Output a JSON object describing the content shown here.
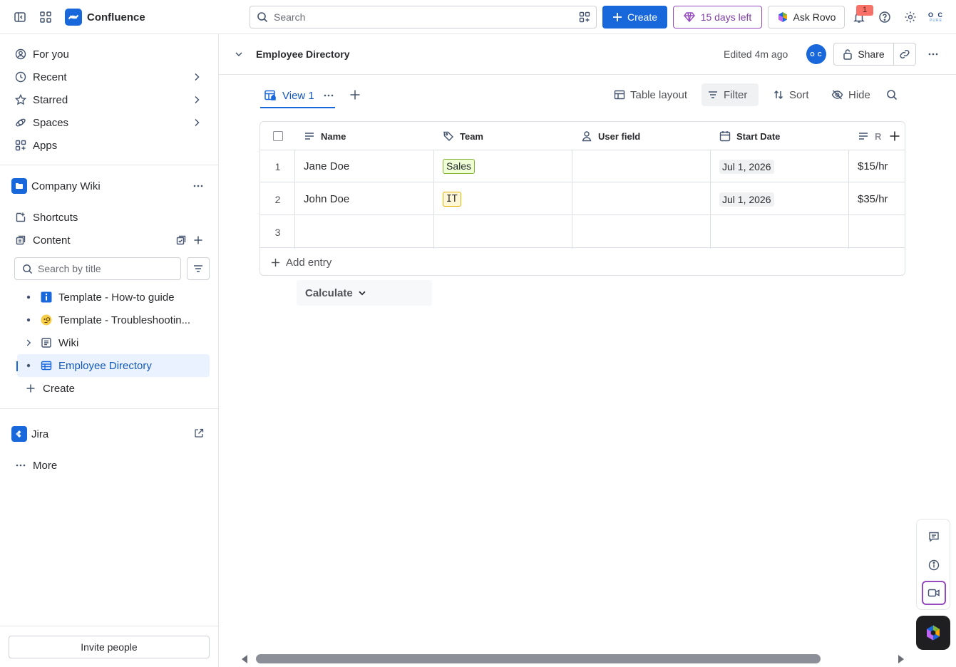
{
  "topbar": {
    "app_name": "Confluence",
    "search_placeholder": "Search",
    "create_label": "Create",
    "trial_label": "15 days left",
    "rovo_label": "Ask Rovo",
    "notification_count": "1",
    "avatar_initials": "O C",
    "avatar_sub": "PURE"
  },
  "sidebar": {
    "nav": [
      {
        "label": "For you"
      },
      {
        "label": "Recent"
      },
      {
        "label": "Starred"
      },
      {
        "label": "Spaces"
      },
      {
        "label": "Apps"
      }
    ],
    "space_name": "Company Wiki",
    "shortcuts_label": "Shortcuts",
    "content_label": "Content",
    "search_placeholder": "Search by title",
    "tree": [
      {
        "label": "Template - How-to guide"
      },
      {
        "label": "Template - Troubleshootin..."
      },
      {
        "label": "Wiki"
      },
      {
        "label": "Employee Directory"
      }
    ],
    "create_label": "Create",
    "jira_label": "Jira",
    "more_label": "More",
    "invite_label": "Invite people"
  },
  "header": {
    "title": "Employee Directory",
    "edited": "Edited 4m ago",
    "avatar_initials": "O C",
    "share_label": "Share"
  },
  "toolbar": {
    "view_label": "View 1",
    "table_layout_label": "Table layout",
    "filter_label": "Filter",
    "sort_label": "Sort",
    "hide_label": "Hide"
  },
  "table": {
    "columns": [
      {
        "label": "Name"
      },
      {
        "label": "Team"
      },
      {
        "label": "User field"
      },
      {
        "label": "Start Date"
      },
      {
        "label": "R"
      }
    ],
    "rows": [
      {
        "num": "1",
        "name": "Jane Doe",
        "team": "Sales",
        "user": "",
        "start": "Jul 1, 2026",
        "rate": "$15/hr"
      },
      {
        "num": "2",
        "name": "John Doe",
        "team": "IT",
        "user": "",
        "start": "Jul 1, 2026",
        "rate": "$35/hr"
      },
      {
        "num": "3",
        "name": "",
        "team": "",
        "user": "",
        "start": "",
        "rate": ""
      }
    ],
    "add_entry_label": "Add entry",
    "calculate_label": "Calculate"
  },
  "colors": {
    "brand": "#1868db",
    "trial_purple": "#964ac0",
    "tag_sales_bg": "#efffd6",
    "tag_it_bg": "#fff7d6"
  },
  "icons": {
    "sidebar_toggle": "sidebar-toggle-icon",
    "app_switcher": "app-switcher-icon",
    "notifications": "bell-icon",
    "help": "help-icon",
    "settings": "gear-icon"
  }
}
